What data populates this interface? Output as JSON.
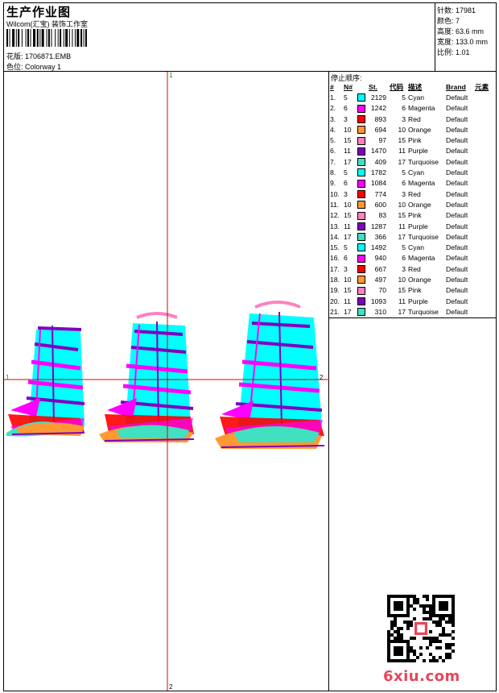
{
  "header": {
    "title": "生产作业图",
    "company": "Wilcom(汇宝) 装饰工作室",
    "design_label": "花版:",
    "design_file": "1706871.EMB",
    "colorway_label": "色位:",
    "colorway": "Colorway 1"
  },
  "stats": [
    {
      "label": "针数:",
      "value": "17981"
    },
    {
      "label": "颜色:",
      "value": "7"
    },
    {
      "label": "高度:",
      "value": "63.6 mm"
    },
    {
      "label": "宽度:",
      "value": "133.0 mm"
    },
    {
      "label": "比例:",
      "value": "1.01"
    }
  ],
  "sequence": {
    "title": "停止顺序:",
    "columns": [
      "#",
      "N#",
      "St.",
      "代码",
      "描述",
      "Brand",
      "元素"
    ],
    "rows": [
      {
        "idx": "1.",
        "n": "5",
        "color": "#00ffff",
        "st": "2129",
        "code": "5",
        "desc": "Cyan",
        "brand": "Default"
      },
      {
        "idx": "2.",
        "n": "6",
        "color": "#ff00ff",
        "st": "1242",
        "code": "6",
        "desc": "Magenta",
        "brand": "Default"
      },
      {
        "idx": "3.",
        "n": "3",
        "color": "#ff0000",
        "st": "893",
        "code": "3",
        "desc": "Red",
        "brand": "Default"
      },
      {
        "idx": "4.",
        "n": "10",
        "color": "#ff9933",
        "st": "694",
        "code": "10",
        "desc": "Orange",
        "brand": "Default"
      },
      {
        "idx": "5.",
        "n": "15",
        "color": "#ff80c0",
        "st": "97",
        "code": "15",
        "desc": "Pink",
        "brand": "Default"
      },
      {
        "idx": "6.",
        "n": "11",
        "color": "#8000c0",
        "st": "1470",
        "code": "11",
        "desc": "Purple",
        "brand": "Default"
      },
      {
        "idx": "7.",
        "n": "17",
        "color": "#40e0c0",
        "st": "409",
        "code": "17",
        "desc": "Turquoise",
        "brand": "Default"
      },
      {
        "idx": "8.",
        "n": "5",
        "color": "#00ffff",
        "st": "1782",
        "code": "5",
        "desc": "Cyan",
        "brand": "Default"
      },
      {
        "idx": "9.",
        "n": "6",
        "color": "#ff00ff",
        "st": "1084",
        "code": "6",
        "desc": "Magenta",
        "brand": "Default"
      },
      {
        "idx": "10.",
        "n": "3",
        "color": "#ff0000",
        "st": "774",
        "code": "3",
        "desc": "Red",
        "brand": "Default"
      },
      {
        "idx": "11.",
        "n": "10",
        "color": "#ff9933",
        "st": "600",
        "code": "10",
        "desc": "Orange",
        "brand": "Default"
      },
      {
        "idx": "12.",
        "n": "15",
        "color": "#ff80c0",
        "st": "83",
        "code": "15",
        "desc": "Pink",
        "brand": "Default"
      },
      {
        "idx": "13.",
        "n": "11",
        "color": "#8000c0",
        "st": "1287",
        "code": "11",
        "desc": "Purple",
        "brand": "Default"
      },
      {
        "idx": "14.",
        "n": "17",
        "color": "#40e0c0",
        "st": "366",
        "code": "17",
        "desc": "Turquoise",
        "brand": "Default"
      },
      {
        "idx": "15.",
        "n": "5",
        "color": "#00ffff",
        "st": "1492",
        "code": "5",
        "desc": "Cyan",
        "brand": "Default"
      },
      {
        "idx": "16.",
        "n": "6",
        "color": "#ff00ff",
        "st": "940",
        "code": "6",
        "desc": "Magenta",
        "brand": "Default"
      },
      {
        "idx": "17.",
        "n": "3",
        "color": "#ff0000",
        "st": "667",
        "code": "3",
        "desc": "Red",
        "brand": "Default"
      },
      {
        "idx": "18.",
        "n": "10",
        "color": "#ff9933",
        "st": "497",
        "code": "10",
        "desc": "Orange",
        "brand": "Default"
      },
      {
        "idx": "19.",
        "n": "15",
        "color": "#ff80c0",
        "st": "70",
        "code": "15",
        "desc": "Pink",
        "brand": "Default"
      },
      {
        "idx": "20.",
        "n": "11",
        "color": "#8000c0",
        "st": "1093",
        "code": "11",
        "desc": "Purple",
        "brand": "Default"
      },
      {
        "idx": "21.",
        "n": "17",
        "color": "#40e0c0",
        "st": "310",
        "code": "17",
        "desc": "Turquoise",
        "brand": "Default"
      }
    ]
  },
  "canvas": {
    "axis_labels": {
      "top": "1",
      "bottom": "2",
      "left": "1",
      "right": "2"
    },
    "crosshair_color": "#e00000"
  },
  "watermark": {
    "text": "6xiu.com",
    "color": "#e8465a"
  },
  "qr_icon": "qr-code-icon"
}
